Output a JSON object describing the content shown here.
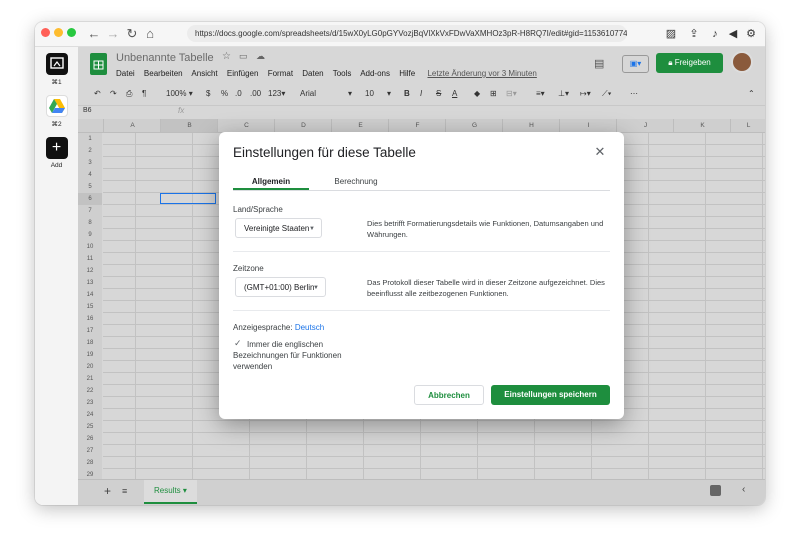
{
  "browser": {
    "url": "https://docs.google.com/spreadsheets/d/15wX0yLG0pGYVozjBqVlXkVxFDwVaXMHOz3pR-H8RQ7I/edit#gid=1153610774"
  },
  "sidebar": {
    "items": [
      {
        "label": "⌘1",
        "icon": "app-window-icon"
      },
      {
        "label": "⌘2",
        "icon": "google-drive-icon"
      },
      {
        "label": "Add",
        "icon": "plus-icon"
      }
    ]
  },
  "sheets": {
    "title": "Unbenannte Tabelle",
    "menu": [
      "Datei",
      "Bearbeiten",
      "Ansicht",
      "Einfügen",
      "Format",
      "Daten",
      "Tools",
      "Add-ons",
      "Hilfe"
    ],
    "last_edit": "Letzte Änderung vor 3 Minuten",
    "share_label": "Freigeben",
    "toolbar": {
      "zoom": "100%",
      "currency": "$",
      "percent": "%",
      "dec_decrease": ".0",
      "dec_increase": ".00",
      "number_format": "123",
      "font": "Arial",
      "font_size": "10"
    },
    "cell_ref": "B6",
    "fx": "fx",
    "columns": [
      "A",
      "B",
      "C",
      "D",
      "E",
      "F",
      "G",
      "H",
      "I",
      "J",
      "K",
      "L"
    ],
    "rows": [
      "1",
      "2",
      "3",
      "4",
      "5",
      "6",
      "7",
      "8",
      "9",
      "10",
      "11",
      "12",
      "13",
      "14",
      "15",
      "16",
      "17",
      "18",
      "19",
      "20",
      "21",
      "22",
      "23",
      "24",
      "25",
      "26",
      "27",
      "28",
      "29"
    ],
    "sheet_tab": "Results",
    "accent": "#1e8e3e"
  },
  "dialog": {
    "title": "Einstellungen für diese Tabelle",
    "tabs": [
      "Allgemein",
      "Berechnung"
    ],
    "locale_label": "Land/Sprache",
    "locale_value": "Vereinigte Staaten",
    "locale_desc": "Dies betrifft Formatierungsdetails wie Funktionen, Datumsangaben und Währungen.",
    "timezone_label": "Zeitzone",
    "timezone_value": "(GMT+01:00) Berlin",
    "timezone_desc": "Das Protokoll dieser Tabelle wird in dieser Zeitzone aufgezeichnet. Dies beeinflusst alle zeitbezogenen Funktionen.",
    "display_lang_label": "Anzeigesprache:",
    "display_lang_value": "Deutsch",
    "checkbox_label": "Immer die englischen Bezeichnungen für Funktionen verwenden",
    "cancel_label": "Abbrechen",
    "save_label": "Einstellungen speichern"
  }
}
